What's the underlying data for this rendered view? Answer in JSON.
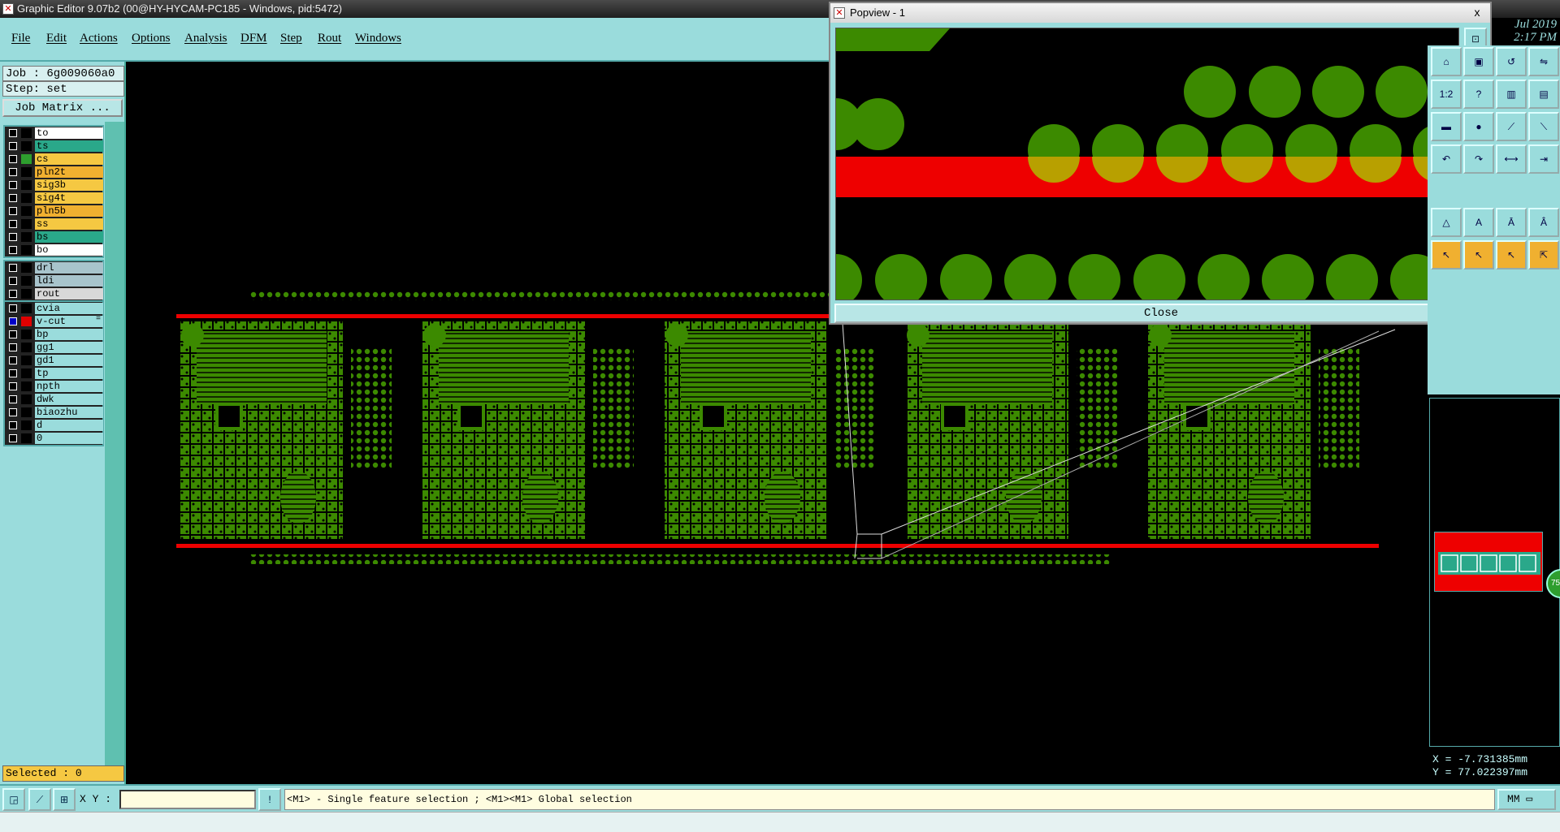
{
  "window": {
    "title": "Graphic Editor 9.07b2 (00@HY-HYCAM-PC185 - Windows, pid:5472)"
  },
  "menu": [
    "File",
    "Edit",
    "Actions",
    "Options",
    "Analysis",
    "DFM",
    "Step",
    "Rout",
    "Windows"
  ],
  "job": {
    "job_label": "Job : 6g009060a0",
    "step_label": "Step: set",
    "matrix_button": "Job Matrix ..."
  },
  "layers_board": [
    {
      "name": "to",
      "color": "#ffffff",
      "swatch": "#000000"
    },
    {
      "name": "ts",
      "color": "#2aa88a",
      "swatch": "#000000"
    },
    {
      "name": "cs",
      "color": "#f5c842",
      "swatch": "#2e9e2e"
    },
    {
      "name": "pln2t",
      "color": "#f0b030",
      "swatch": "#000000"
    },
    {
      "name": "sig3b",
      "color": "#f5c842",
      "swatch": "#000000"
    },
    {
      "name": "sig4t",
      "color": "#f5c842",
      "swatch": "#000000"
    },
    {
      "name": "pln5b",
      "color": "#f0b030",
      "swatch": "#000000"
    },
    {
      "name": "ss",
      "color": "#f5c842",
      "swatch": "#000000"
    },
    {
      "name": "bs",
      "color": "#2aa88a",
      "swatch": "#000000"
    },
    {
      "name": "bo",
      "color": "#ffffff",
      "swatch": "#000000"
    }
  ],
  "layers_drill": [
    {
      "name": "drl",
      "color": "#a8c4cc",
      "swatch": "#000000"
    },
    {
      "name": "ldi",
      "color": "#a8c4cc",
      "swatch": "#000000"
    },
    {
      "name": "rout",
      "color": "#d8d8d8",
      "swatch": "#000000"
    }
  ],
  "layers_misc": [
    {
      "name": "cvia",
      "color": "#9adcdc",
      "swatch": "#000000"
    },
    {
      "name": "v-cut",
      "color": "#9adcdc",
      "swatch": "#e00000",
      "selected": true,
      "flag": "="
    },
    {
      "name": "bp",
      "color": "#9adcdc",
      "swatch": "#000000"
    },
    {
      "name": "gg1",
      "color": "#9adcdc",
      "swatch": "#000000"
    },
    {
      "name": "gd1",
      "color": "#9adcdc",
      "swatch": "#000000"
    },
    {
      "name": "tp",
      "color": "#9adcdc",
      "swatch": "#000000"
    },
    {
      "name": "npth",
      "color": "#9adcdc",
      "swatch": "#000000"
    },
    {
      "name": "dwk",
      "color": "#9adcdc",
      "swatch": "#000000"
    },
    {
      "name": "biaozhu",
      "color": "#9adcdc",
      "swatch": "#000000"
    },
    {
      "name": "d",
      "color": "#9adcdc",
      "swatch": "#000000"
    },
    {
      "name": "0",
      "color": "#9adcdc",
      "swatch": "#000000"
    }
  ],
  "selected_label": "Selected : 0",
  "popview": {
    "title": "Popview - 1",
    "close_button": "Close",
    "close_icon": "x"
  },
  "date": {
    "line1": "Jul 2019",
    "line2": "2:17 PM"
  },
  "coords": {
    "x": "X = -7.731385mm",
    "y": "Y = 77.022397mm"
  },
  "status": {
    "xy_label": "X Y :",
    "xy_value": "",
    "message": "<M1> - Single feature selection ; <M1><M1> Global selection",
    "units": "MM"
  },
  "colors": {
    "panel": "#9adcdc",
    "copper": "#3c8a00",
    "vcut": "#ee0000",
    "highlight": "#f5c842"
  },
  "right_tool_icons": [
    "zoom-home-icon",
    "fit-icon",
    "rotate-icon",
    "mirror-icon",
    "scale-1-2-icon",
    "help-icon",
    "layer-move-icon",
    "layer-copy-icon",
    "ruler-icon",
    "pad-icon",
    "snap-icon",
    "snap2-icon",
    "undo-icon",
    "redo-icon",
    "measure-icon",
    "measure2-icon",
    "text-a-icon",
    "text-a2-icon",
    "text-a3-icon",
    "text-a4-icon",
    "pointer-icon",
    "pointer2-icon",
    "pointer3-icon",
    "pointer4-icon"
  ]
}
